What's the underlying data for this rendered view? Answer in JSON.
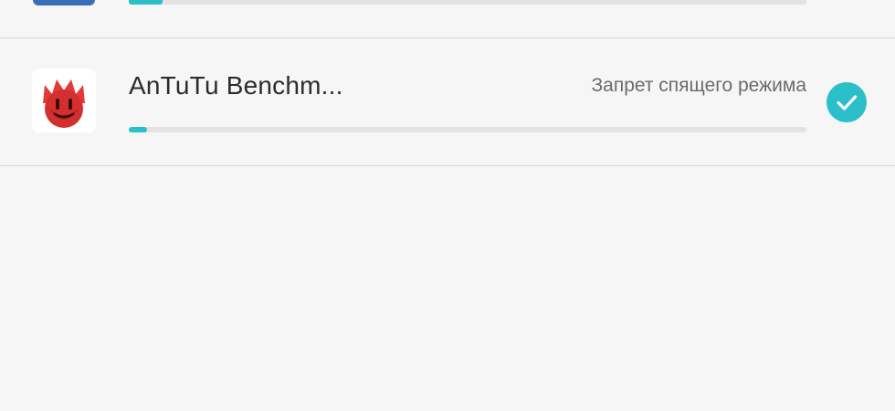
{
  "previous_item": {
    "icon": "app-icon-blue",
    "progress": 0.05
  },
  "app_item": {
    "name": "AnTuTu Benchm...",
    "status": "Запрет спящего режима",
    "icon": "antutu-flame-icon",
    "progress": 0.027,
    "selected": true
  },
  "colors": {
    "accent": "#2bbfca",
    "background": "#f6f6f6",
    "track": "#e3e3e3",
    "antutu_red": "#d32f2f"
  }
}
